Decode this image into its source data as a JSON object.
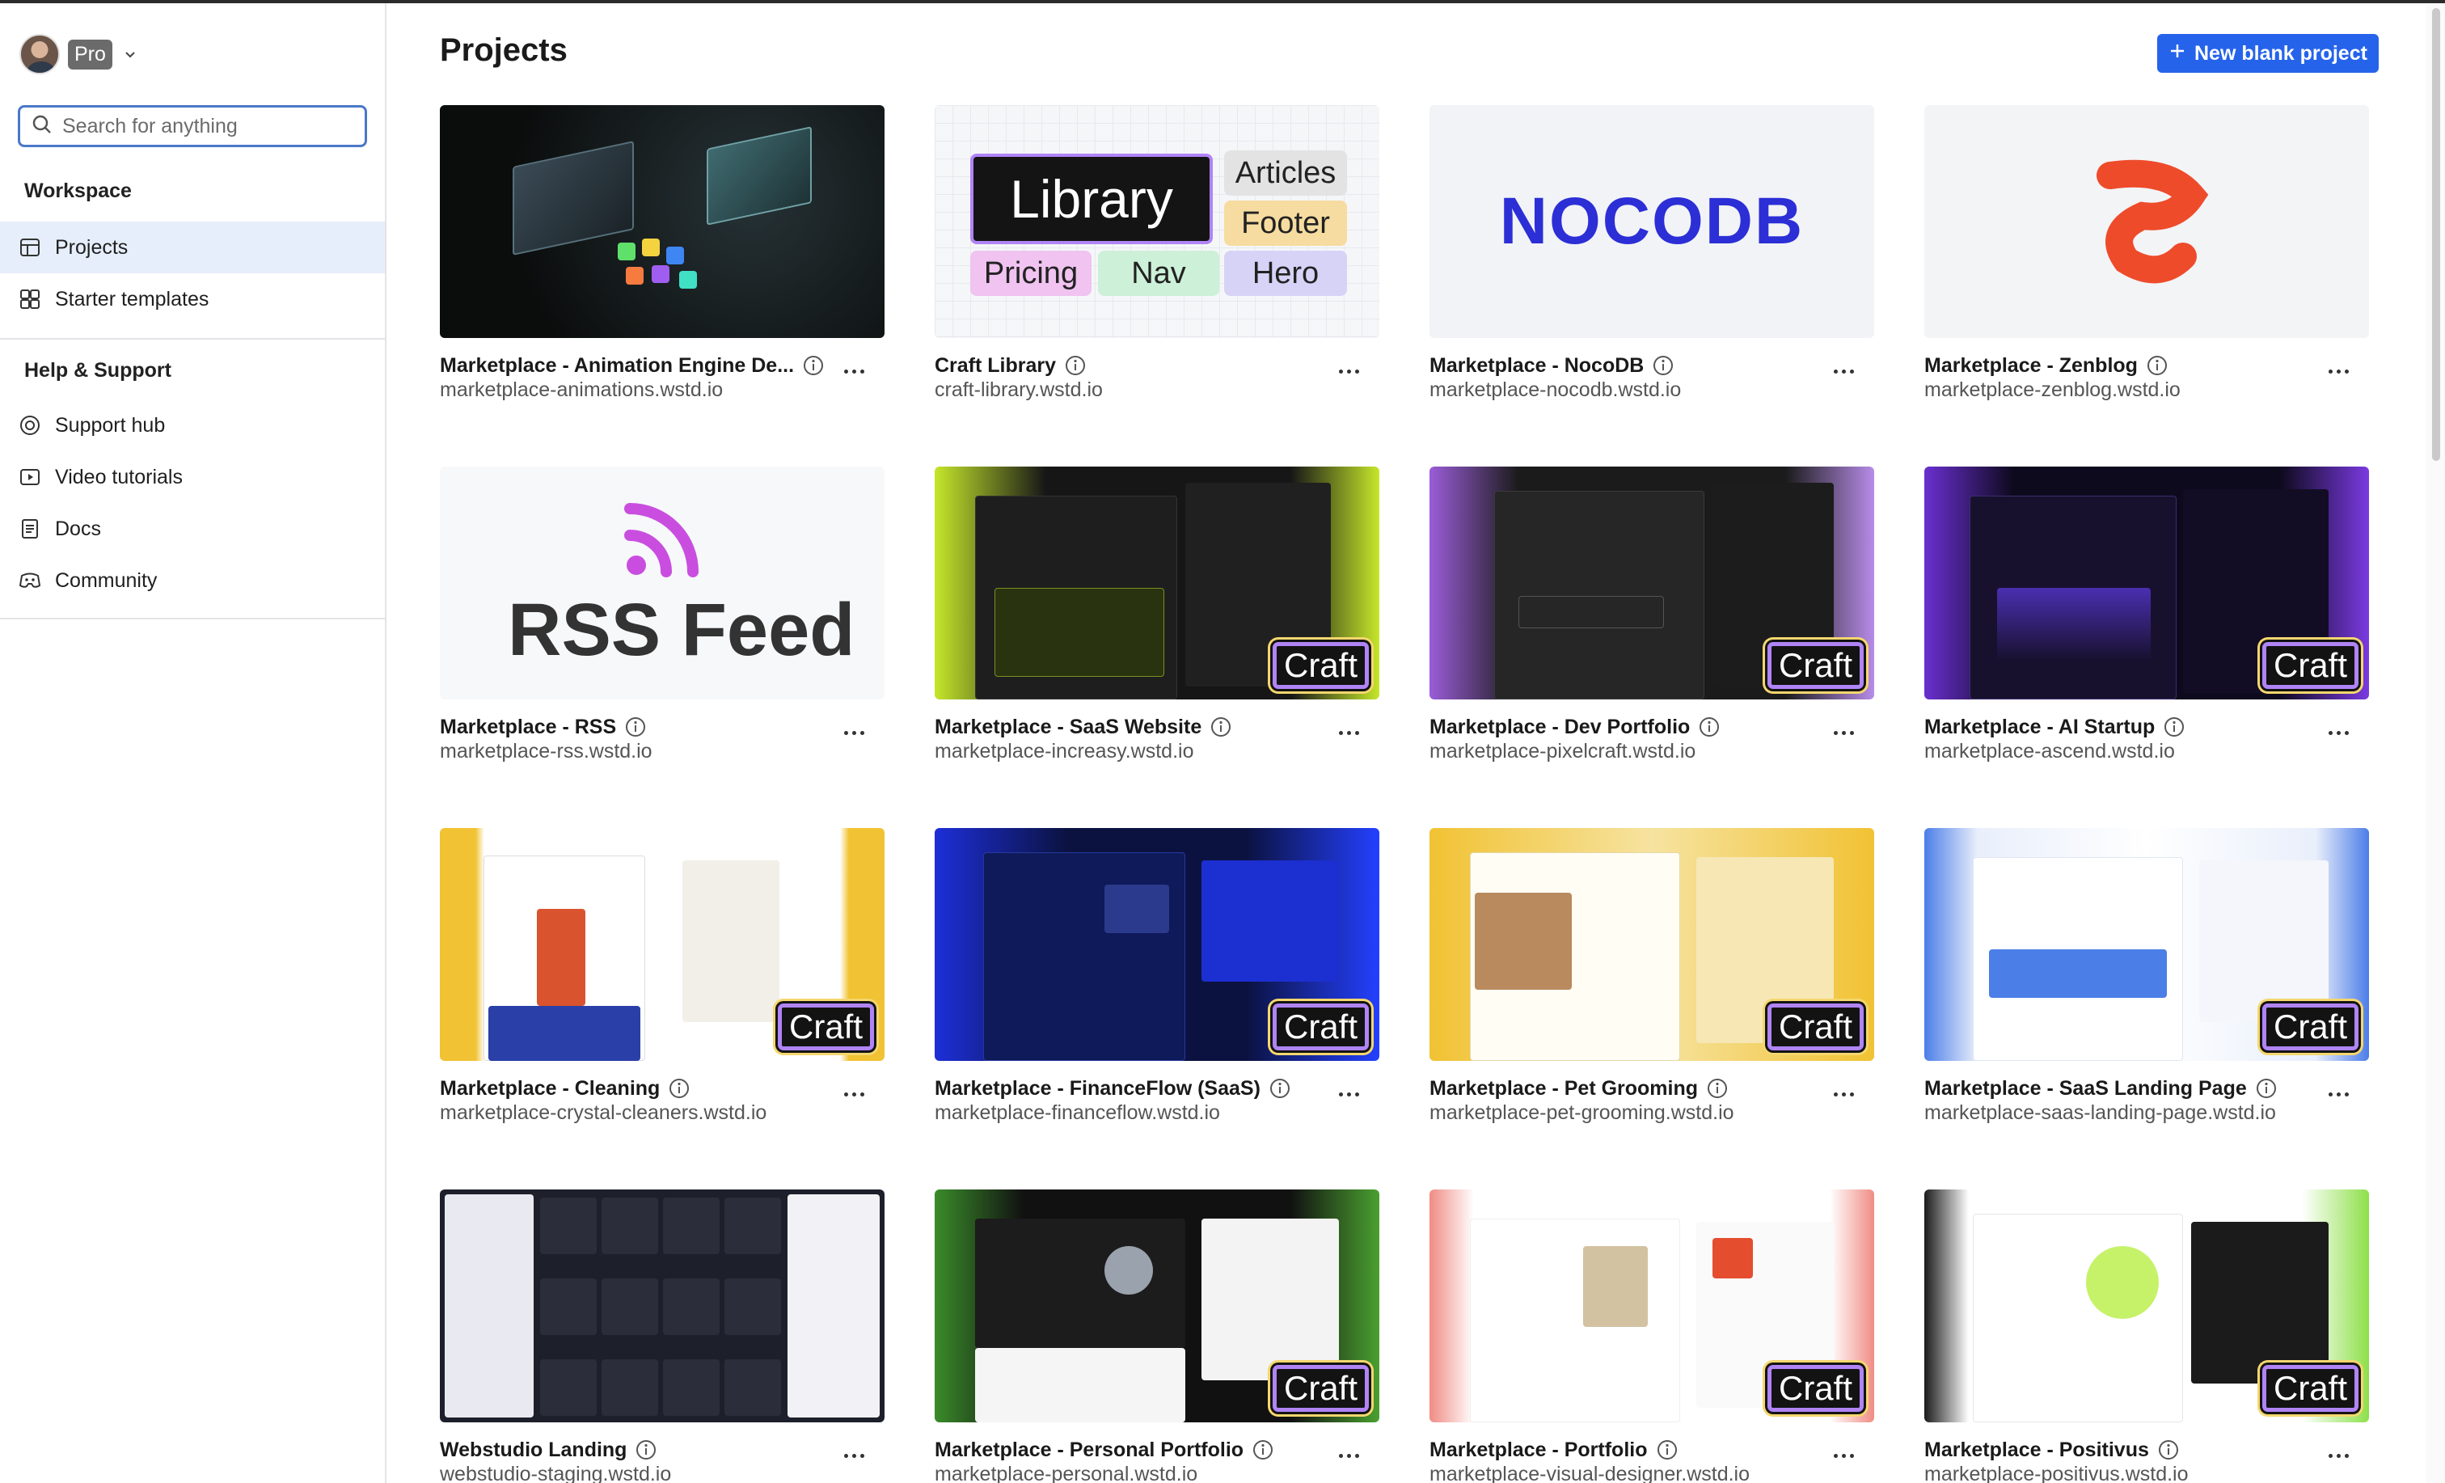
{
  "sidebar": {
    "plan": "Pro",
    "search_placeholder": "Search for anything",
    "workspace_title": "Workspace",
    "workspace_items": [
      {
        "label": "Projects",
        "icon": "layout-icon",
        "active": true
      },
      {
        "label": "Starter templates",
        "icon": "templates-icon",
        "active": false
      }
    ],
    "help_title": "Help & Support",
    "help_items": [
      {
        "label": "Support hub",
        "icon": "support-icon"
      },
      {
        "label": "Video tutorials",
        "icon": "video-icon"
      },
      {
        "label": "Docs",
        "icon": "docs-icon"
      },
      {
        "label": "Community",
        "icon": "community-icon"
      }
    ]
  },
  "main": {
    "title": "Projects",
    "new_button": "New blank project",
    "badge_label": "Craft",
    "library_thumb": {
      "chips": [
        "Library",
        "Articles",
        "Footer",
        "Pricing",
        "Nav",
        "Hero"
      ]
    },
    "nocodb_thumb": "NOCODB",
    "rss_thumb": "RSS Feed",
    "projects": [
      {
        "title": "Marketplace - Animation Engine De...",
        "domain": "marketplace-animations.wstd.io",
        "craft": false
      },
      {
        "title": "Craft Library",
        "domain": "craft-library.wstd.io",
        "craft": false
      },
      {
        "title": "Marketplace - NocoDB",
        "domain": "marketplace-nocodb.wstd.io",
        "craft": false
      },
      {
        "title": "Marketplace - Zenblog",
        "domain": "marketplace-zenblog.wstd.io",
        "craft": false
      },
      {
        "title": "Marketplace - RSS",
        "domain": "marketplace-rss.wstd.io",
        "craft": false
      },
      {
        "title": "Marketplace - SaaS Website",
        "domain": "marketplace-increasy.wstd.io",
        "craft": true
      },
      {
        "title": "Marketplace - Dev Portfolio",
        "domain": "marketplace-pixelcraft.wstd.io",
        "craft": true
      },
      {
        "title": "Marketplace - AI Startup",
        "domain": "marketplace-ascend.wstd.io",
        "craft": true
      },
      {
        "title": "Marketplace - Cleaning",
        "domain": "marketplace-crystal-cleaners.wstd.io",
        "craft": true
      },
      {
        "title": "Marketplace - FinanceFlow (SaaS)",
        "domain": "marketplace-financeflow.wstd.io",
        "craft": true
      },
      {
        "title": "Marketplace - Pet Grooming",
        "domain": "marketplace-pet-grooming.wstd.io",
        "craft": true
      },
      {
        "title": "Marketplace - SaaS Landing Page",
        "domain": "marketplace-saas-landing-page.wstd.io",
        "craft": true
      },
      {
        "title": "Webstudio Landing",
        "domain": "webstudio-staging.wstd.io",
        "craft": false
      },
      {
        "title": "Marketplace - Personal Portfolio",
        "domain": "marketplace-personal.wstd.io",
        "craft": true
      },
      {
        "title": "Marketplace - Portfolio",
        "domain": "marketplace-visual-designer.wstd.io",
        "craft": true
      },
      {
        "title": "Marketplace - Positivus",
        "domain": "marketplace-positivus.wstd.io",
        "craft": true
      }
    ]
  },
  "colors": {
    "accent": "#2563eb",
    "active_nav_bg": "#e6eefb",
    "nocodb_brand": "#2c2ed6",
    "zenblog_brand": "#ee4b2b",
    "rss_brand": "#c94ee0"
  }
}
